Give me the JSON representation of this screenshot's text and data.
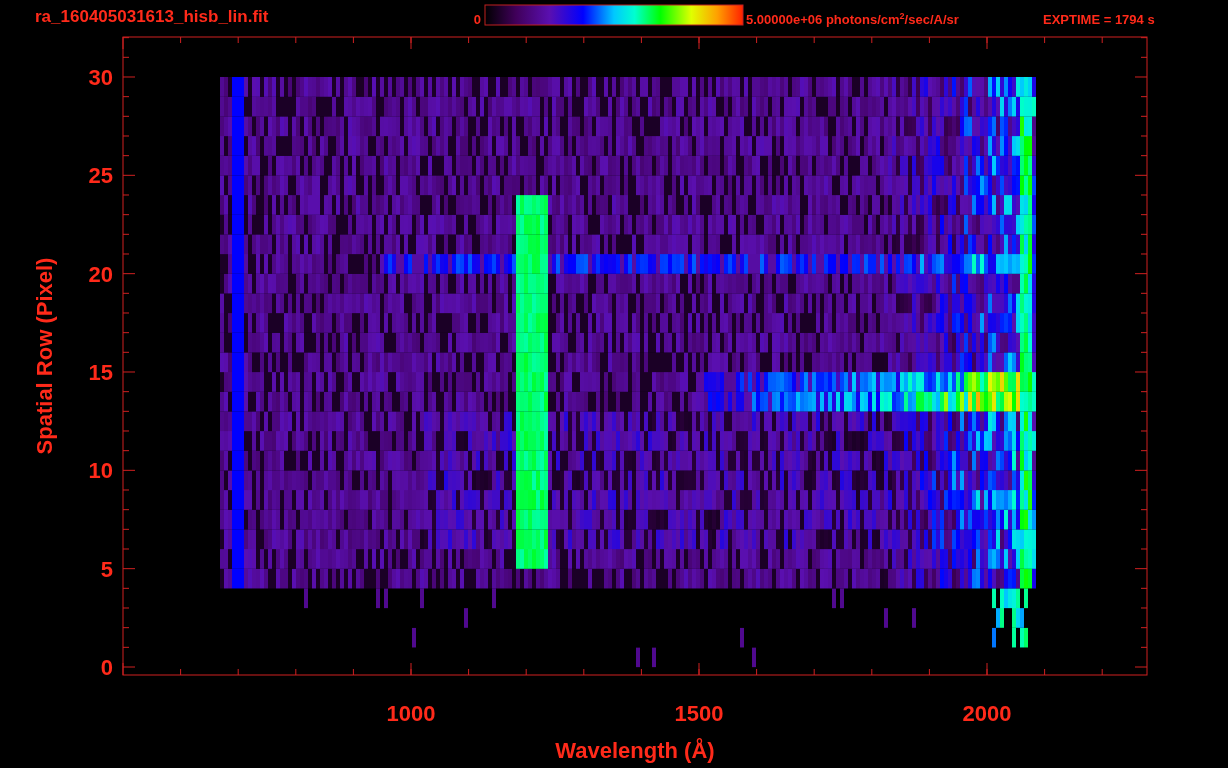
{
  "title": "ra_160405031613_hisb_lin.fit",
  "colorbar": {
    "min_label": "0",
    "max_label": "5.00000e+06 photons/cm$^{2}$/sec/A/sr"
  },
  "exptime": "EXPTIME = 1794 s",
  "plot": {
    "xlabel": "Wavelength (Å)",
    "ylabel": "Spatial Row (Pixel)",
    "xtick_labels": [
      "1000",
      "1500",
      "2000"
    ],
    "ytick_labels": [
      "30",
      "25",
      "20",
      "15",
      "10",
      "5",
      "0"
    ]
  }
}
